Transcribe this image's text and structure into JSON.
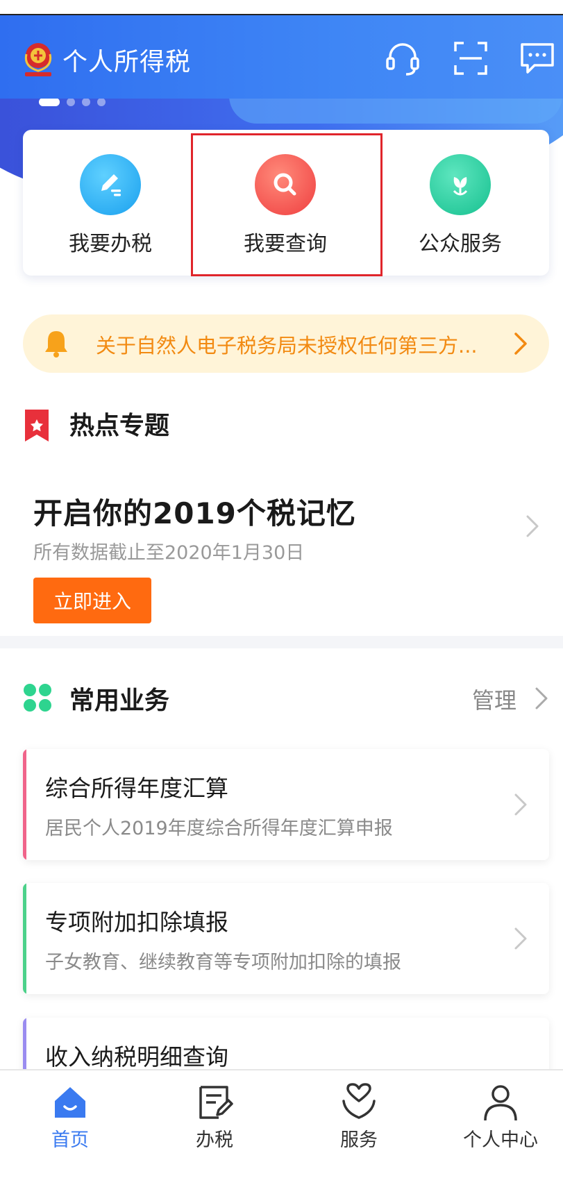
{
  "header": {
    "title": "个人所得税",
    "icons": [
      "customer-service-icon",
      "scan-icon",
      "message-icon"
    ]
  },
  "banner": {
    "dots": 4,
    "active_dot": 1
  },
  "quick_actions": [
    {
      "label": "我要办税",
      "icon": "edit-icon",
      "color": "#2ab3f2"
    },
    {
      "label": "我要查询",
      "icon": "search-icon",
      "color": "#f24a46",
      "highlighted": true
    },
    {
      "label": "公众服务",
      "icon": "flower-icon",
      "color": "#22c79a"
    }
  ],
  "notice": {
    "text": "关于自然人电子税务局未授权任何第三方..."
  },
  "hot_topics": {
    "section_title": "热点专题",
    "title": "开启你的2019个税记忆",
    "subtitle": "所有数据截止至2020年1月30日",
    "button": "立即进入"
  },
  "common_business": {
    "section_title": "常用业务",
    "manage_label": "管理",
    "items": [
      {
        "title": "综合所得年度汇算",
        "subtitle": "居民个人2019年度综合所得年度汇算申报",
        "accent": "#f0648a"
      },
      {
        "title": "专项附加扣除填报",
        "subtitle": "子女教育、继续教育等专项附加扣除的填报",
        "accent": "#4cd18a"
      },
      {
        "title": "收入纳税明细查询",
        "subtitle": "",
        "accent": "#9a8cf0"
      }
    ]
  },
  "tabbar": {
    "active_color": "#3a7af0",
    "items": [
      {
        "label": "首页",
        "icon": "home-icon",
        "active": true
      },
      {
        "label": "办税",
        "icon": "tax-document-icon",
        "active": false
      },
      {
        "label": "服务",
        "icon": "service-heart-icon",
        "active": false
      },
      {
        "label": "个人中心",
        "icon": "user-icon",
        "active": false
      }
    ]
  }
}
